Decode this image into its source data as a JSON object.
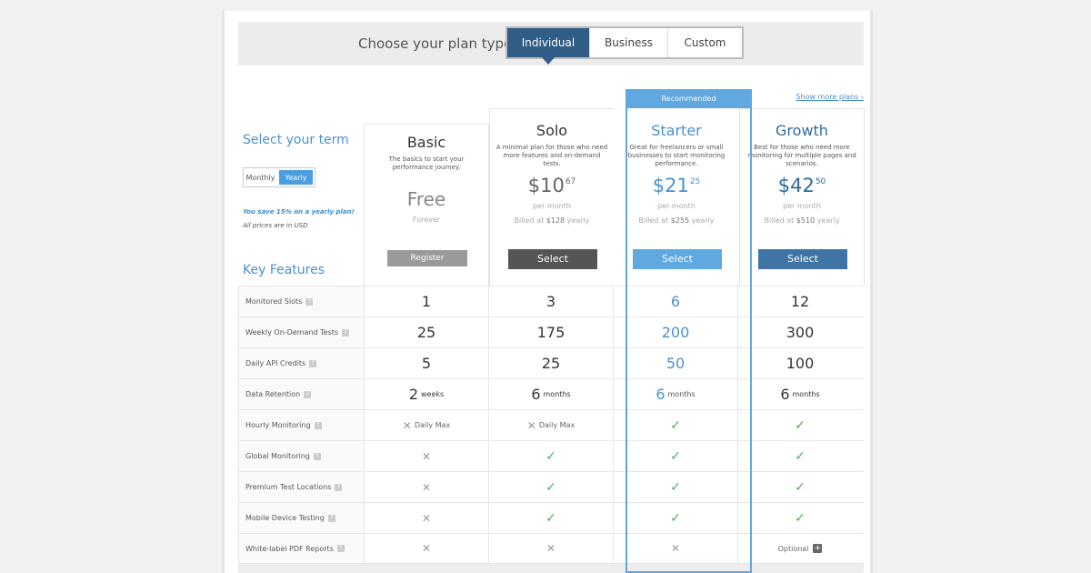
{
  "header": {
    "label": "Choose your plan type",
    "tabs": [
      "Individual",
      "Business",
      "Custom"
    ],
    "show_more": "Show more plans ›"
  },
  "term": {
    "title": "Select your term",
    "options": [
      "Monthly",
      "Yearly"
    ],
    "save_note": "You save 15% on a yearly plan!",
    "prices_note": "All prices are in USD"
  },
  "key_features_title": "Key Features",
  "recommended": "Recommended",
  "plans": [
    {
      "name": "Basic",
      "desc": "The basics to start your performance journey.",
      "price": "Free",
      "cents": "",
      "per": "Forever",
      "billed_pre": "",
      "billed_amount": "",
      "billed_post": "",
      "button": "Register"
    },
    {
      "name": "Solo",
      "desc": "A minimal plan for those who need more features and on-demand tests.",
      "price": "$10",
      "cents": "67",
      "per": "per month",
      "billed_pre": "Billed at ",
      "billed_amount": "$128",
      "billed_post": " yearly",
      "button": "Select"
    },
    {
      "name": "Starter",
      "desc": "Great for freelancers or small businesses to start monitoring performance.",
      "price": "$21",
      "cents": "25",
      "per": "per month",
      "billed_pre": "Billed at ",
      "billed_amount": "$255",
      "billed_post": " yearly",
      "button": "Select"
    },
    {
      "name": "Growth",
      "desc": "Best for those who need more monitoring for multiple pages and scenarios.",
      "price": "$42",
      "cents": "50",
      "per": "per month",
      "billed_pre": "Billed at ",
      "billed_amount": "$510",
      "billed_post": " yearly",
      "button": "Select"
    }
  ],
  "question_mark": "?",
  "plus_sign": "+",
  "features": [
    {
      "label": "Monitored Slots",
      "values": [
        "1",
        "3",
        "6",
        "12"
      ]
    },
    {
      "label": "Weekly On-Demand Tests",
      "values": [
        "25",
        "175",
        "200",
        "300"
      ]
    },
    {
      "label": "Daily API Credits",
      "values": [
        "5",
        "25",
        "50",
        "100"
      ]
    },
    {
      "label": "Data Retention",
      "values": [
        "2",
        "6",
        "6",
        "6"
      ],
      "units": [
        "weeks",
        "months",
        "months",
        "months"
      ]
    },
    {
      "label": "Hourly Monitoring",
      "values": [
        "✕",
        "✕",
        "✓",
        "✓"
      ],
      "notes": [
        "Daily Max",
        "Daily Max",
        "",
        ""
      ]
    },
    {
      "label": "Global Monitoring",
      "values": [
        "✕",
        "✓",
        "✓",
        "✓"
      ]
    },
    {
      "label": "Premium Test Locations",
      "values": [
        "✕",
        "✓",
        "✓",
        "✓"
      ]
    },
    {
      "label": "Mobile Device Testing",
      "values": [
        "✕",
        "✓",
        "✓",
        "✓"
      ]
    },
    {
      "label": "White-label PDF Reports",
      "values": [
        "✕",
        "✕",
        "✕",
        "Optional"
      ]
    }
  ]
}
